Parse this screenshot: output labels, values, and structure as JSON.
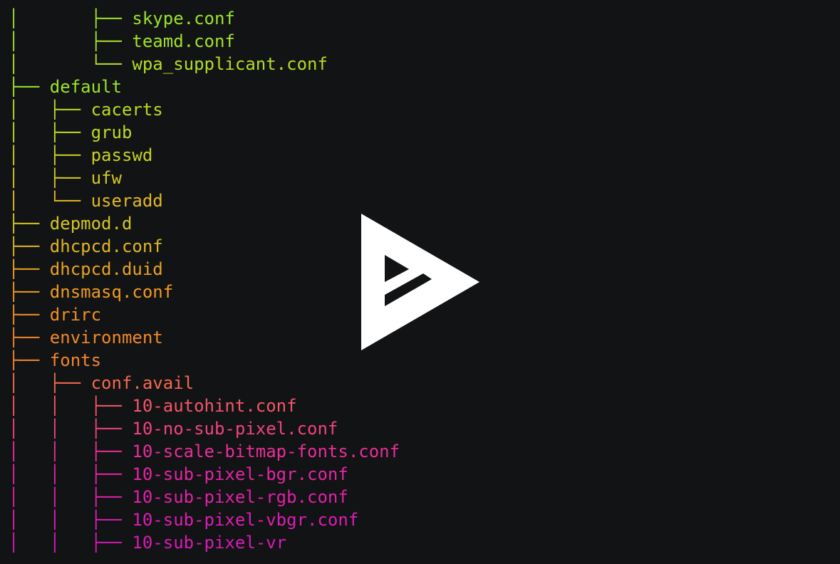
{
  "terminal": {
    "lines": [
      {
        "prefix": "│       ├── ",
        "name": "skype.conf",
        "color": "#9be32b"
      },
      {
        "prefix": "│       ├── ",
        "name": "teamd.conf",
        "color": "#a3e12a"
      },
      {
        "prefix": "│       └── ",
        "name": "wpa_supplicant.conf",
        "color": "#b5dc25"
      },
      {
        "prefix": "├── ",
        "name": "default",
        "color": "#9be32b"
      },
      {
        "prefix": "│   ├── ",
        "name": "cacerts",
        "color": "#b9da24"
      },
      {
        "prefix": "│   ├── ",
        "name": "grub",
        "color": "#bfd823"
      },
      {
        "prefix": "│   ├── ",
        "name": "passwd",
        "color": "#c9d022"
      },
      {
        "prefix": "│   ├── ",
        "name": "ufw",
        "color": "#d2c821"
      },
      {
        "prefix": "│   └── ",
        "name": "useradd",
        "color": "#e2b925"
      },
      {
        "prefix": "├── ",
        "name": "depmod.d",
        "color": "#d3c624"
      },
      {
        "prefix": "├── ",
        "name": "dhcpcd.conf",
        "color": "#e0b524"
      },
      {
        "prefix": "├── ",
        "name": "dhcpcd.duid",
        "color": "#e8a222"
      },
      {
        "prefix": "├── ",
        "name": "dnsmasq.conf",
        "color": "#ef9a23"
      },
      {
        "prefix": "├── ",
        "name": "drirc",
        "color": "#f08f25"
      },
      {
        "prefix": "├── ",
        "name": "environment",
        "color": "#f2882a"
      },
      {
        "prefix": "├── ",
        "name": "fonts",
        "color": "#f28530"
      },
      {
        "prefix": "│   ├── ",
        "name": "conf.avail",
        "color": "#f46a50"
      },
      {
        "prefix": "│   │   ├── ",
        "name": "10-autohint.conf",
        "color": "#f2566a"
      },
      {
        "prefix": "│   │   ├── ",
        "name": "10-no-sub-pixel.conf",
        "color": "#f0447c"
      },
      {
        "prefix": "│   │   ├── ",
        "name": "10-scale-bitmap-fonts.conf",
        "color": "#e92d9a"
      },
      {
        "prefix": "│   │   ├── ",
        "name": "10-sub-pixel-bgr.conf",
        "color": "#e524a4"
      },
      {
        "prefix": "│   │   ├── ",
        "name": "10-sub-pixel-rgb.conf",
        "color": "#e21fab"
      },
      {
        "prefix": "│   │   ├── ",
        "name": "10-sub-pixel-vbgr.conf",
        "color": "#dc1db4"
      },
      {
        "prefix": "│   │   ├── ",
        "name": "10-sub-pixel-vr",
        "color": "#d81ab9"
      }
    ]
  },
  "overlay": {
    "icon": "play-logo-icon",
    "color": "#ffffff"
  }
}
